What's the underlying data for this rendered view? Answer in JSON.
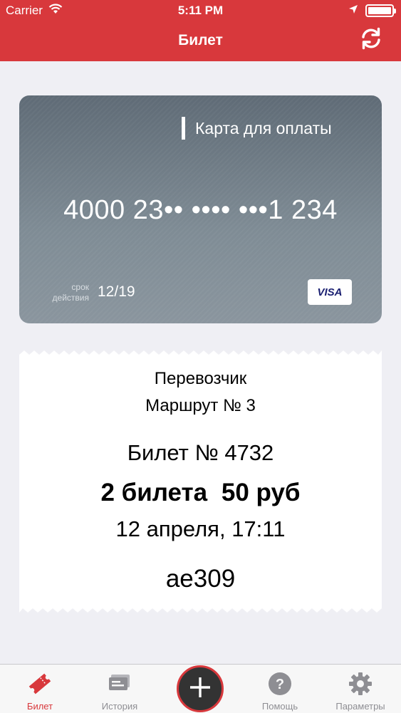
{
  "status_bar": {
    "carrier": "Carrier",
    "time": "5:11 PM",
    "battery_level": 1.0
  },
  "header": {
    "title": "Билет",
    "refresh_icon": "refresh-icon"
  },
  "card": {
    "label": "Карта для оплаты",
    "number": "4000 23•• •••• •••1 234",
    "expiry_caption_line1": "срок",
    "expiry_caption_line2": "действия",
    "expiry": "12/19",
    "network": "VISA"
  },
  "ticket": {
    "carrier": "Перевозчик",
    "route": "Маршрут № 3",
    "ticket_number": "Билет № 4732",
    "count": "2 билета",
    "price": "50 руб",
    "datetime": "12 апреля, 17:11",
    "code": "ae309"
  },
  "tabbar": {
    "tabs": [
      {
        "label": "Билет",
        "icon": "ticket-icon",
        "active": true
      },
      {
        "label": "История",
        "icon": "history-icon",
        "active": false
      },
      {
        "label": "Помощь",
        "icon": "help-icon",
        "active": false
      },
      {
        "label": "Параметры",
        "icon": "gear-icon",
        "active": false
      }
    ],
    "add_icon": "plus-icon"
  },
  "colors": {
    "accent": "#d8383c",
    "background": "#efeff4",
    "card_top": "#5f6b76",
    "card_bottom": "#8a959e",
    "tab_inactive": "#8e8e93"
  }
}
